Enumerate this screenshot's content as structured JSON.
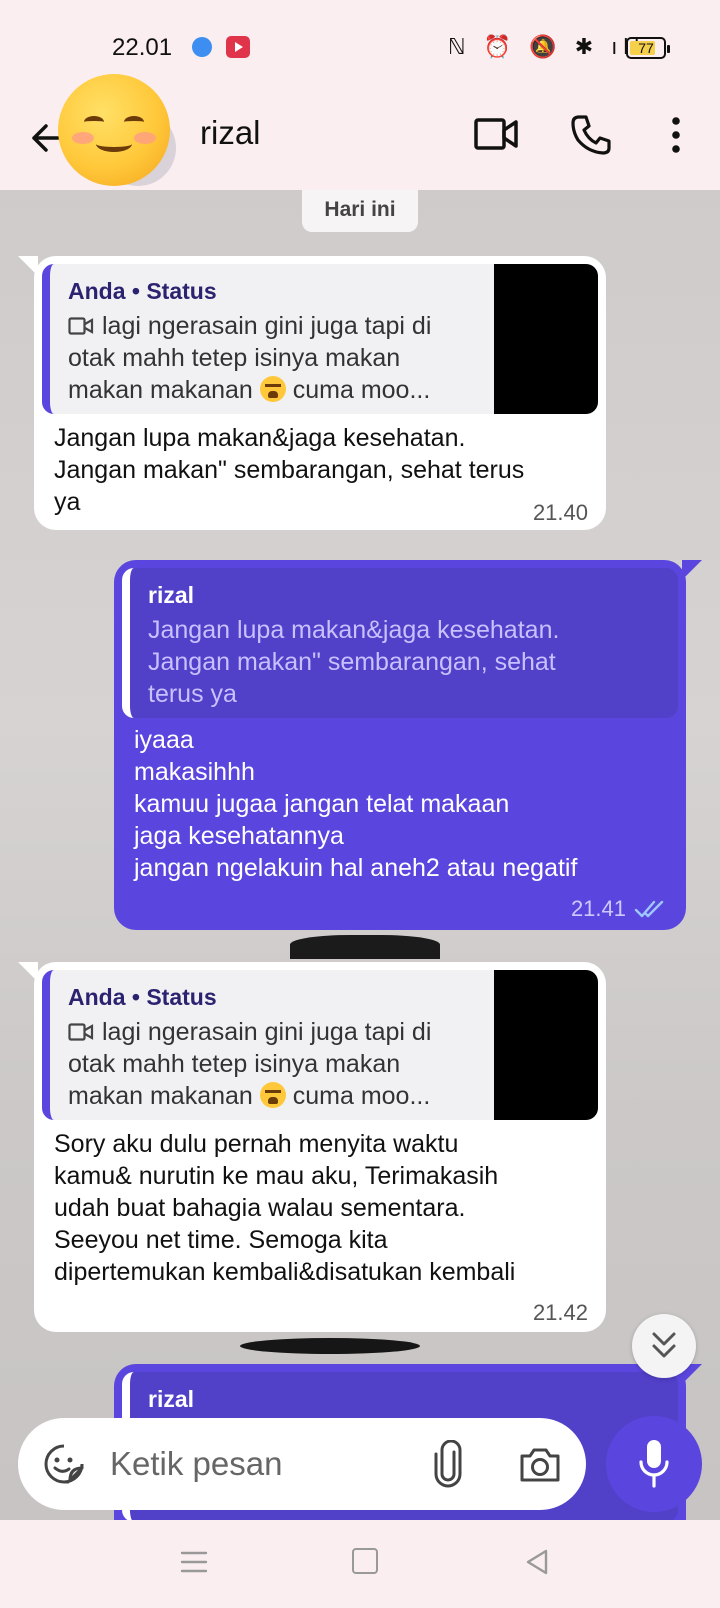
{
  "status_bar": {
    "time": "22.01",
    "icons_text": "ℕ ⏰ 🔕 ✱ ıll",
    "battery": "77",
    "battery_level": 0.77
  },
  "header": {
    "contact_name": "rizal"
  },
  "chat": {
    "date_chip": "Hari ini",
    "messages": [
      {
        "direction": "in",
        "quote_author": "Anda • Status",
        "quote_text_a": "lagi ngerasain gini juga tapi di otak mahh tetep isinya makan makan makanan",
        "quote_text_b": "cuma moo...",
        "text": "Jangan lupa makan&jaga kesehatan.\nJangan makan\" sembarangan, sehat terus\nya",
        "time": "21.40"
      },
      {
        "direction": "out",
        "quote_author": "rizal",
        "quote_text": "Jangan lupa makan&jaga kesehatan.\nJangan makan\" sembarangan, sehat\nterus ya",
        "text": "iyaaa\nmakasihhh\nkamuu jugaa jangan telat makaan\njaga  kesehatannya\njangan ngelakuin hal aneh2 atau negatif",
        "time": "21.41"
      },
      {
        "direction": "in",
        "quote_author": "Anda • Status",
        "quote_text_a": "lagi ngerasain gini juga tapi di otak mahh tetep isinya makan makan makanan",
        "quote_text_b": "cuma moo...",
        "text": "Sory aku dulu pernah menyita waktu\nkamu& nurutin ke mau aku, Terimakasih\nudah buat bahagia walau sementara.\nSeeyou net time. Semoga kita\ndipertemukan kembali&disatukan kembali",
        "time": "21.42"
      },
      {
        "direction": "out",
        "quote_author": "rizal"
      }
    ]
  },
  "composer": {
    "placeholder": "Ketik pesan"
  },
  "colors": {
    "accent": "#5a46de",
    "background": "#fbeef0",
    "incoming_bubble": "#ffffff"
  },
  "icons": [
    "back-icon",
    "video-call-icon",
    "phone-icon",
    "more-icon",
    "sticker-icon",
    "attach-icon",
    "camera-icon",
    "mic-icon",
    "scroll-down-icon"
  ]
}
